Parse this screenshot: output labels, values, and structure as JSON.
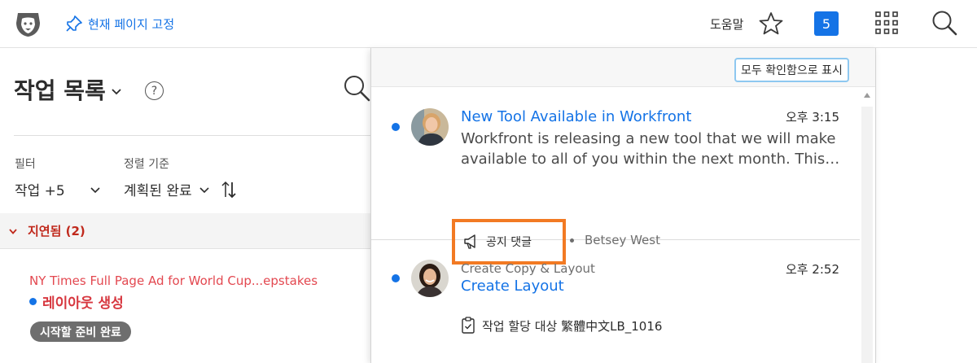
{
  "topbar": {
    "logo_icon": "lion-logo-icon",
    "pin_label": "현재 페이지 고정",
    "help_label": "도움말",
    "notification_count": "5",
    "accent": "#1473e6"
  },
  "page": {
    "title": "작업 목록",
    "help_glyph": "?",
    "filter_label": "필터",
    "filter_value": "작업 +5",
    "sort_label": "정렬 기준",
    "sort_value": "계획된 완료"
  },
  "section": {
    "label": "지연됨 (2)",
    "color": "#c0291c"
  },
  "task": {
    "project": "NY Times Full Page Ad for World Cup...epstakes",
    "name": "레이아웃 생성",
    "status": "시작할 준비 완료"
  },
  "panel": {
    "mark_all_label": "모두 확인함으로 표시",
    "notifications": [
      {
        "title": "New Tool Available in Workfront",
        "time": "오후 3:15",
        "body": "Workfront is releasing a new tool that we will make available to all of you within the next month. This…",
        "type_label": "공지 댓글",
        "author": "Betsey West",
        "unread": true
      },
      {
        "project": "Create Copy & Layout",
        "title": "Create Layout",
        "time": "오후 2:52",
        "assignment": "작업 할당 대상 繁體中文LB_1016",
        "unread": true
      }
    ]
  }
}
